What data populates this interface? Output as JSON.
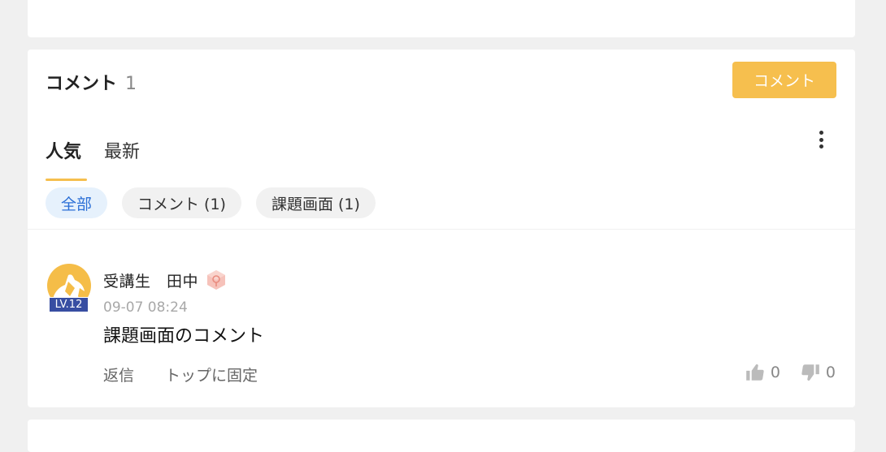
{
  "comments_section": {
    "title": "コメント",
    "count": "1",
    "post_button": "コメント"
  },
  "tabs": [
    {
      "label": "人気",
      "active": true
    },
    {
      "label": "最新",
      "active": false
    }
  ],
  "filters": [
    {
      "label": "全部",
      "active": true
    },
    {
      "label": "コメント (1)",
      "active": false
    },
    {
      "label": "課題画面 (1)",
      "active": false
    }
  ],
  "comment": {
    "author": "受講生　田中",
    "level_badge": "LV.12",
    "timestamp": "09-07 08:24",
    "text": "課題画面のコメント",
    "reply_label": "返信",
    "pin_label": "トップに固定",
    "likes": "0",
    "dislikes": "0"
  },
  "icons": {
    "menu": "more-vertical-icon",
    "gem": "gem-icon",
    "like": "thumbs-up-icon",
    "dislike": "thumbs-down-icon"
  },
  "colors": {
    "accent": "#f6bf4e",
    "active_chip_text": "#2b6fd6",
    "active_chip_bg": "#e6f1fc",
    "level_badge_bg": "#384ea2"
  }
}
